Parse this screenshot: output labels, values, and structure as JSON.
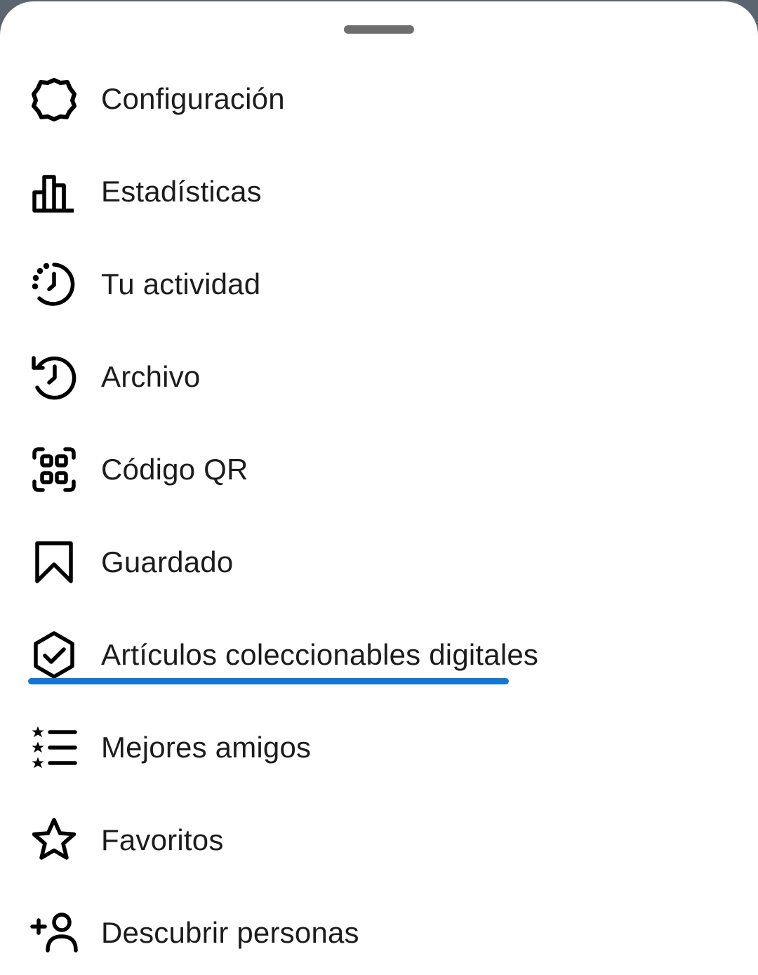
{
  "menu": {
    "items": [
      {
        "label": "Configuración",
        "icon": "gear-icon"
      },
      {
        "label": "Estadísticas",
        "icon": "bar-chart-icon"
      },
      {
        "label": "Tu actividad",
        "icon": "activity-clock-icon"
      },
      {
        "label": "Archivo",
        "icon": "history-icon"
      },
      {
        "label": "Código QR",
        "icon": "qr-scan-icon"
      },
      {
        "label": "Guardado",
        "icon": "bookmark-icon"
      },
      {
        "label": "Artículos coleccionables digitales",
        "icon": "hexagon-check-icon"
      },
      {
        "label": "Mejores amigos",
        "icon": "star-list-icon"
      },
      {
        "label": "Favoritos",
        "icon": "star-icon"
      },
      {
        "label": "Descubrir personas",
        "icon": "add-person-icon"
      }
    ]
  },
  "colors": {
    "text": "#1c1c1c",
    "icon": "#000000",
    "highlight_underline": "#1677d2",
    "handle": "#6e6e6e",
    "backdrop": "#5b6570"
  }
}
